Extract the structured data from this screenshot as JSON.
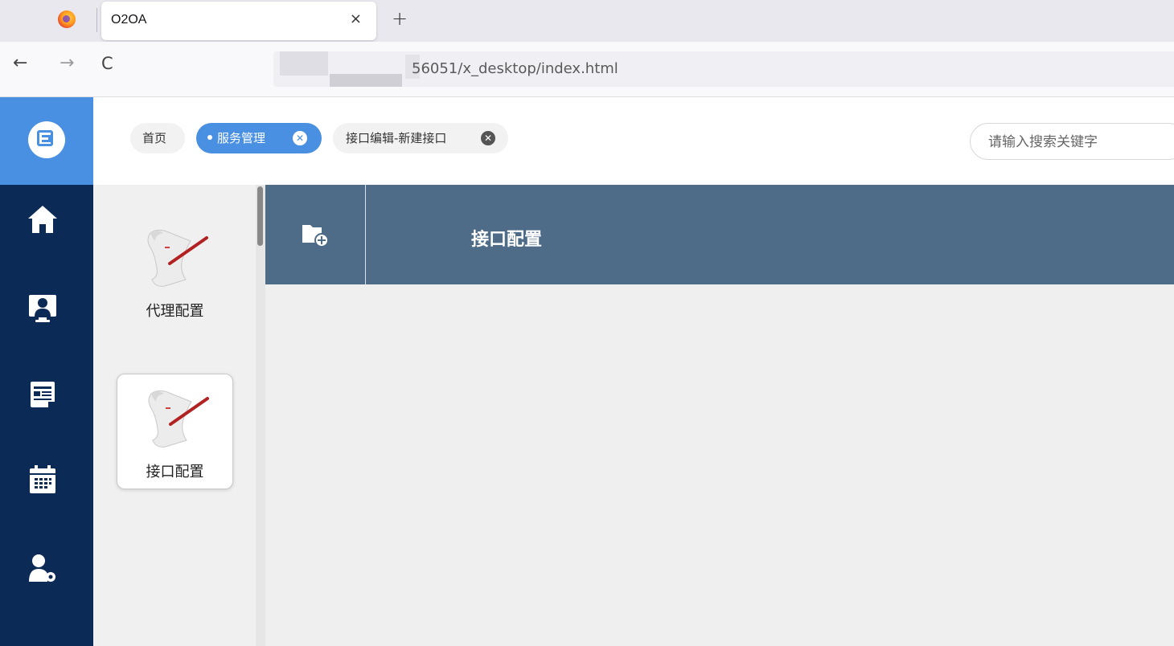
{
  "browser": {
    "tab_title": "O2OA",
    "tab_close": "×",
    "new_tab": "+",
    "url": "56051/x_desktop/index.html",
    "back": "←",
    "forward": "→",
    "reload": "C"
  },
  "header": {
    "chips": {
      "home": "首页",
      "active": "服务管理",
      "edit": "接口编辑-新建接口"
    },
    "close_glyph": "✕",
    "search_placeholder": "请输入搜索关键字"
  },
  "left_nav": {
    "icons": [
      "home-icon",
      "monitor-user-icon",
      "calendar-notes-icon",
      "calendar-grid-icon",
      "user-settings-icon"
    ]
  },
  "modules": [
    {
      "label": "代理配置",
      "selected": false
    },
    {
      "label": "接口配置",
      "selected": true
    }
  ],
  "toolbar": {
    "title": "接口配置",
    "add_icon": "folder-add-icon"
  },
  "colors": {
    "logo_blue": "#4a90e2",
    "nav_dark": "#0c2a56",
    "toolbar": "#4e6b87"
  }
}
